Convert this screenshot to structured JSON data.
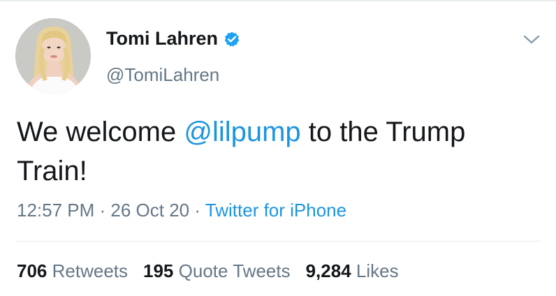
{
  "user": {
    "display_name": "Tomi Lahren",
    "handle": "@TomiLahren",
    "verified": true,
    "avatar_icon": "profile-photo"
  },
  "tweet": {
    "text_before": "We welcome ",
    "mention": "@lilpump",
    "text_after": " to the Trump Train!"
  },
  "meta": {
    "time": "12:57 PM",
    "date": "26 Oct 20",
    "separator": " · ",
    "source": "Twitter for iPhone"
  },
  "stats": [
    {
      "count": "706",
      "label": "Retweets"
    },
    {
      "count": "195",
      "label": "Quote Tweets"
    },
    {
      "count": "9,284",
      "label": "Likes"
    }
  ],
  "colors": {
    "link": "#1b95e0",
    "secondary_text": "#657786",
    "primary_text": "#14171a",
    "verified_badge": "#1da1f2"
  }
}
